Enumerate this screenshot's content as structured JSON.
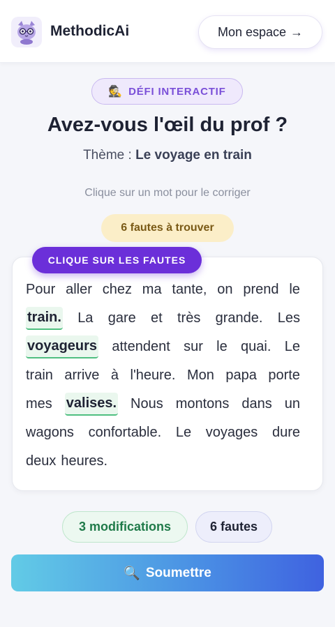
{
  "header": {
    "brand": "MethodicAi",
    "logo_icon": "cat-mascot-icon",
    "espace_label": "Mon espace",
    "espace_arrow": "→"
  },
  "challenge": {
    "badge_emoji": "🕵️",
    "badge_label": "DÉFI INTERACTIF",
    "title": "Avez-vous l'œil du prof ?",
    "theme_prefix": "Thème :",
    "theme_value": "Le voyage en train",
    "hint": "Clique sur un mot pour le corriger",
    "count_label": "6 fautes à trouver",
    "card_tag": "CLIQUE SUR LES FAUTES"
  },
  "text": {
    "lines": [
      [
        "Pour",
        "aller",
        "chez",
        "ma",
        "tante,",
        "on",
        "prend",
        "le"
      ],
      [
        "train.",
        "La",
        "gare",
        "et",
        "très",
        "grande.",
        "Les"
      ],
      [
        "voyageurs",
        "attendent",
        "sur",
        "le",
        "quai.",
        "Le"
      ],
      [
        "train",
        "arrive",
        "à",
        "l'heure.",
        "Mon",
        "papa",
        "porte"
      ],
      [
        "mes",
        "valises.",
        "Nous",
        "montons",
        "dans",
        "un"
      ],
      [
        "wagons",
        "confortable.",
        "Le",
        "voyages",
        "dure"
      ],
      [
        "deux",
        "heures."
      ]
    ]
  },
  "status": {
    "modifications": "3 modifications",
    "fautes": "6 fautes"
  },
  "submit": {
    "emoji": "🔍",
    "label": "Soumettre"
  },
  "colors": {
    "accent_purple": "#6b2fd9",
    "highlight_green": "#4fbf80",
    "submit_gradient_start": "#62cbe6",
    "submit_gradient_end": "#3f62e0"
  }
}
